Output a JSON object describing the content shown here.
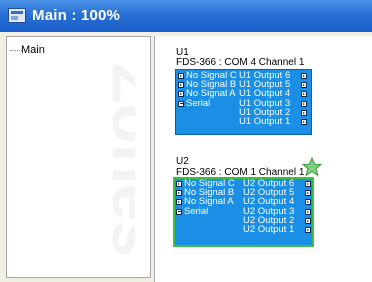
{
  "window": {
    "title": "Main : 100%"
  },
  "tree": {
    "items": [
      "Main"
    ],
    "watermark": "Zones"
  },
  "devices": [
    {
      "name": "U1",
      "subtitle": "FDS-366 : COM 4 Channel 1",
      "inputs": [
        "No Signal C",
        "No Signal B",
        "No Signal A",
        "Serial"
      ],
      "outputs": [
        "U1 Output 6",
        "U1 Output 5",
        "U1 Output 4",
        "U1 Output 3",
        "U1 Output 2",
        "U1 Output 1"
      ],
      "selected": false
    },
    {
      "name": "U2",
      "subtitle": "FDS-366 : COM 1 Channel 1",
      "inputs": [
        "No Signal C",
        "No Signal B",
        "No Signal A",
        "Serial"
      ],
      "outputs": [
        "U2 Output 6",
        "U2 Output 5",
        "U2 Output 4",
        "U2 Output 3",
        "U2 Output 2",
        "U2 Output 1"
      ],
      "selected": true
    }
  ],
  "colors": {
    "card": "#1b8ee6",
    "selection": "#3fbf3f",
    "titlebar": "#2a6fd6"
  },
  "icons": {
    "window": "window-icon",
    "favorite": "star-icon"
  }
}
